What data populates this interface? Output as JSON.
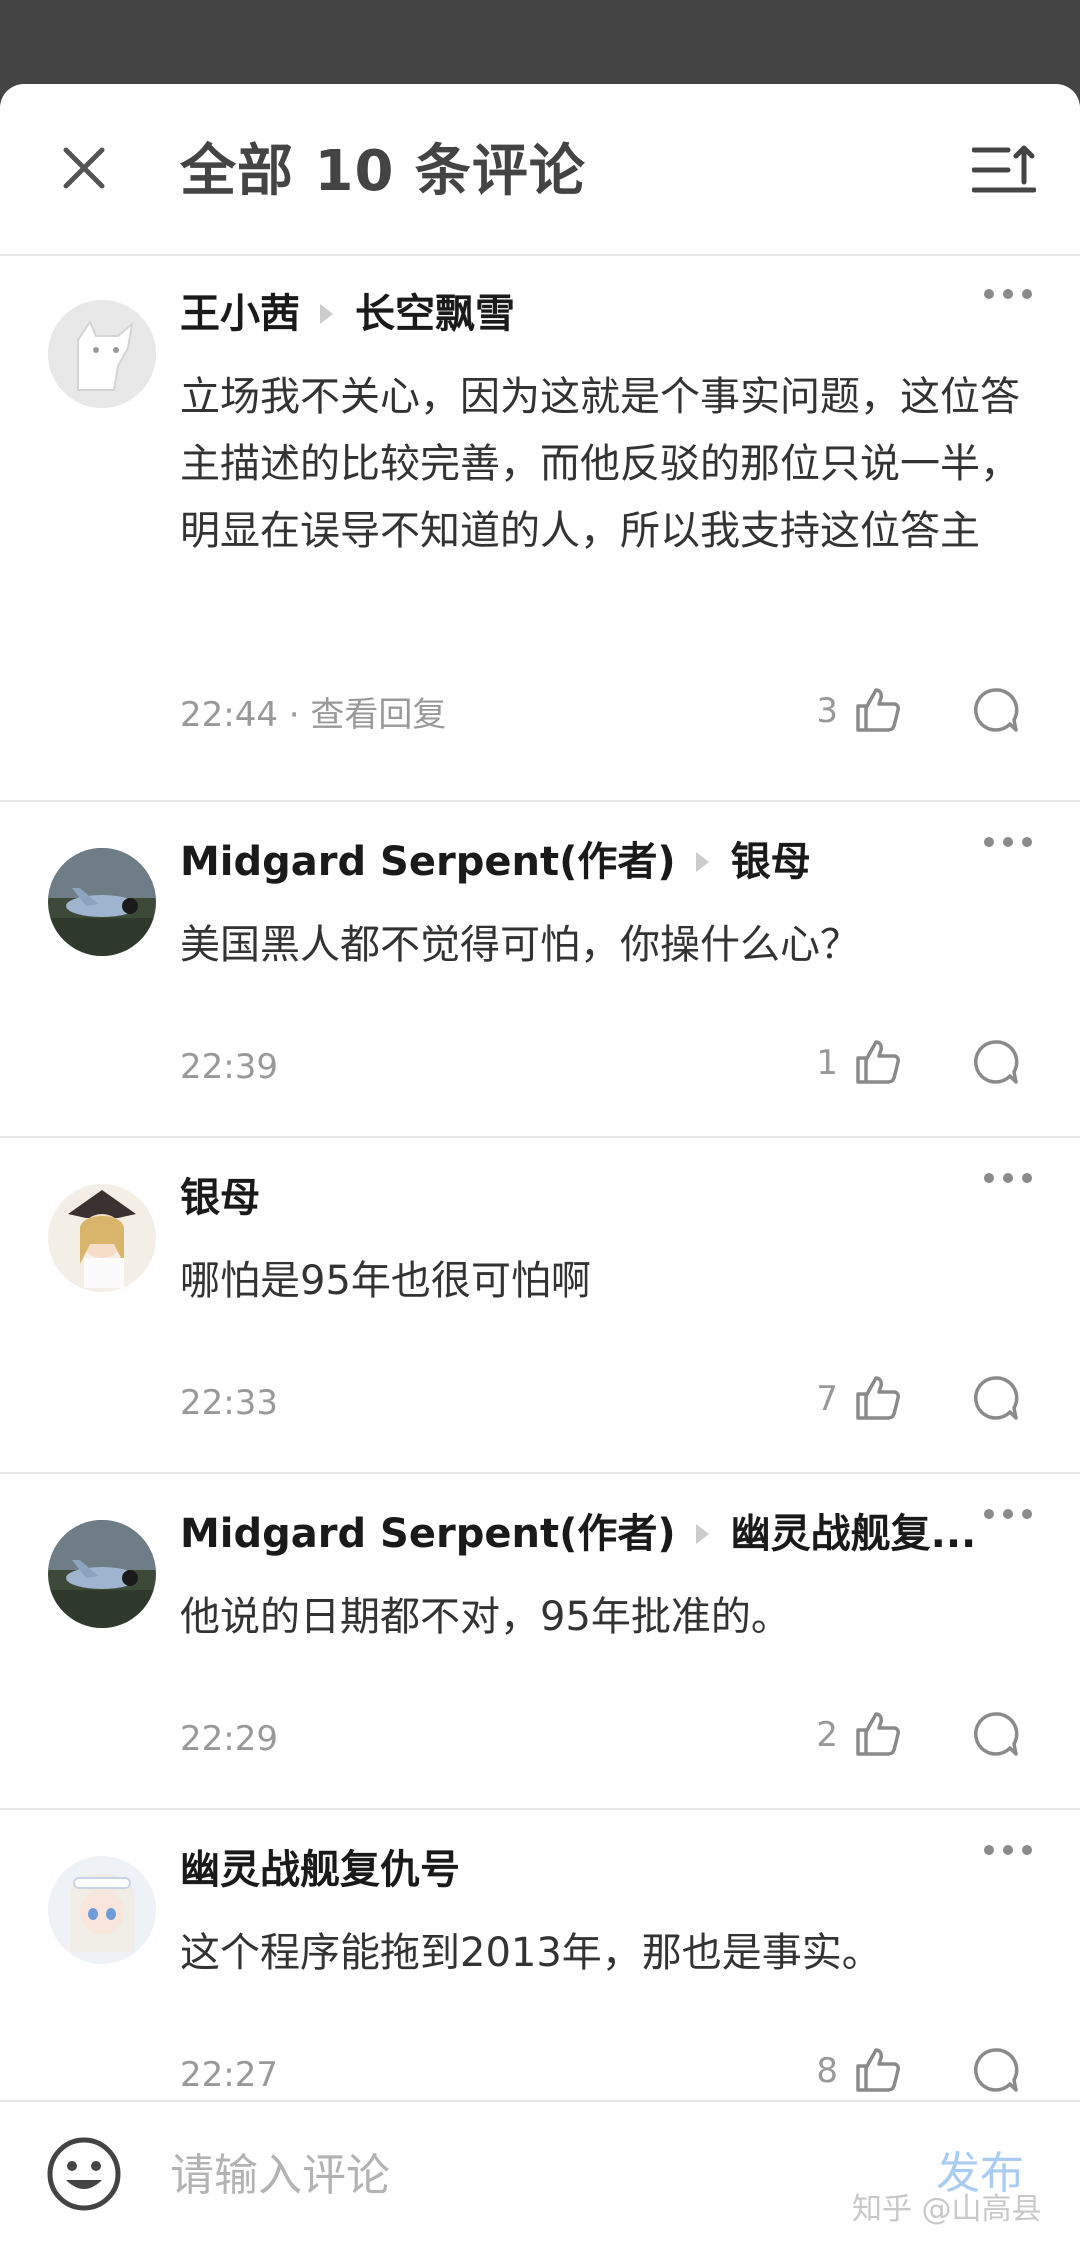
{
  "header": {
    "title": "全部 10 条评论"
  },
  "comments": [
    {
      "author": "王小茜",
      "reply_to": "长空飘雪",
      "text": "立场我不关心，因为这就是个事实问题，这位答主描述的比较完善，而他反驳的那位只说一半，明显在误导不知道的人，所以我支持这位答主",
      "time": "22:44 · 查看回复",
      "likes": "3",
      "avatar": "default-cat-avatar"
    },
    {
      "author": "Midgard Serpent(作者)",
      "reply_to": "银母",
      "text": "美国黑人都不觉得可怕，你操什么心？",
      "time": "22:39",
      "likes": "1",
      "avatar": "airplane-avatar"
    },
    {
      "author": "银母",
      "reply_to": "",
      "text": "哪怕是95年也很可怕啊",
      "time": "22:33",
      "likes": "7",
      "avatar": "anime-girl-avatar"
    },
    {
      "author": "Midgard Serpent(作者)",
      "reply_to": "幽灵战舰复...",
      "text": "他说的日期都不对，95年批准的。",
      "time": "22:29",
      "likes": "2",
      "avatar": "airplane-avatar"
    },
    {
      "author": "幽灵战舰复仇号",
      "reply_to": "",
      "text": "这个程序能拖到2013年，那也是事实。",
      "time": "22:27",
      "likes": "8",
      "avatar": "anime-sailor-avatar"
    }
  ],
  "footer": {
    "placeholder": "请输入评论",
    "publish_label": "发布",
    "watermark": "知乎 @山高县"
  },
  "colors": {
    "overlay": "#444444",
    "publish_disabled": "#a9ccf2",
    "text_primary": "#1a1a1a",
    "text_secondary": "#999999"
  }
}
